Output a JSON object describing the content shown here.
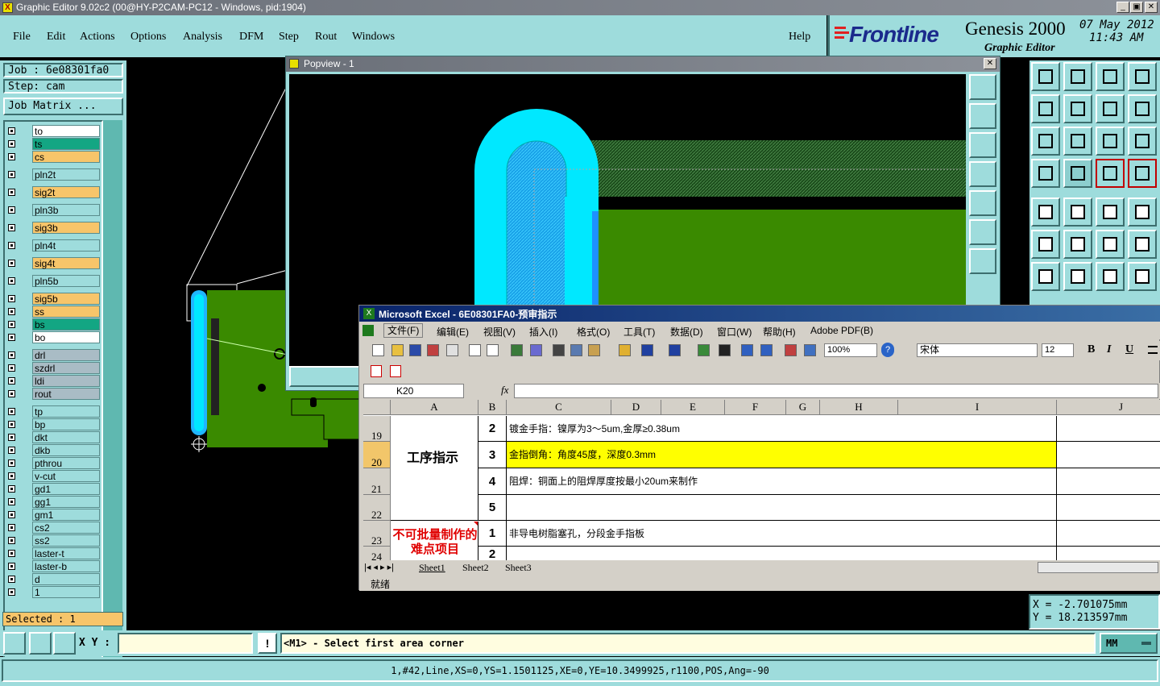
{
  "title_bar": {
    "text": "Graphic Editor 9.02c2 (00@HY-P2CAM-PC12 - Windows, pid:1904)",
    "min": "_",
    "restore": "▣",
    "close": "✕"
  },
  "menu": {
    "items": [
      "File",
      "Edit",
      "Actions",
      "Options",
      "Analysis",
      "DFM",
      "Step",
      "Rout",
      "Windows"
    ],
    "help": "Help"
  },
  "brand": {
    "logo": "Frontline",
    "product": "Genesis 2000",
    "subtitle": "Graphic Editor",
    "date": "07 May 2012",
    "time": "11:43 AM"
  },
  "job": {
    "job_label": "Job : 6e08301fa0",
    "step_label": "Step: cam",
    "matrix_button": "Job Matrix ..."
  },
  "layers": [
    {
      "name": "to",
      "color": "#ffffff"
    },
    {
      "name": "ts",
      "color": "#13a683"
    },
    {
      "name": "cs",
      "color": "#f7c56a"
    },
    {
      "name": "pln2t",
      "color": "#9edcdc"
    },
    {
      "name": "sig2t",
      "color": "#f7c56a"
    },
    {
      "name": "pln3b",
      "color": "#9edcdc"
    },
    {
      "name": "sig3b",
      "color": "#f7c56a"
    },
    {
      "name": "pln4t",
      "color": "#9edcdc"
    },
    {
      "name": "sig4t",
      "color": "#f7c56a"
    },
    {
      "name": "pln5b",
      "color": "#9edcdc"
    },
    {
      "name": "sig5b",
      "color": "#f7c56a"
    },
    {
      "name": "ss",
      "color": "#f7c56a"
    },
    {
      "name": "bs",
      "color": "#13a683"
    },
    {
      "name": "bo",
      "color": "#ffffff"
    },
    {
      "name": "drl",
      "color": "#a9bcc5"
    },
    {
      "name": "szdrl",
      "color": "#a9bcc5"
    },
    {
      "name": "ldi",
      "color": "#a9bcc5"
    },
    {
      "name": "rout",
      "color": "#a9bcc5"
    },
    {
      "name": "tp",
      "color": "#9edcdc"
    },
    {
      "name": "bp",
      "color": "#9edcdc"
    },
    {
      "name": "dkt",
      "color": "#9edcdc"
    },
    {
      "name": "dkb",
      "color": "#9edcdc"
    },
    {
      "name": "pthrou",
      "color": "#9edcdc"
    },
    {
      "name": "v-cut",
      "color": "#9edcdc"
    },
    {
      "name": "gd1",
      "color": "#9edcdc"
    },
    {
      "name": "gg1",
      "color": "#9edcdc"
    },
    {
      "name": "gm1",
      "color": "#9edcdc"
    },
    {
      "name": "cs2",
      "color": "#9edcdc"
    },
    {
      "name": "ss2",
      "color": "#9edcdc"
    },
    {
      "name": "laster-t",
      "color": "#9edcdc"
    },
    {
      "name": "laster-b",
      "color": "#9edcdc"
    },
    {
      "name": "d",
      "color": "#9edcdc"
    },
    {
      "name": "1",
      "color": "#9edcdc"
    }
  ],
  "selected": "Selected : 1",
  "popview": {
    "title": "Popview - 1",
    "close": "✕"
  },
  "coords": {
    "x": "X  = -2.701075mm",
    "y": "Y  = 18.213597mm"
  },
  "bottom": {
    "xy_label": "X Y :",
    "xy_value": "",
    "bang": "!",
    "prompt": "<M1> - Select first area corner",
    "units": "MM"
  },
  "status_line": "1,#42,Line,XS=0,YS=1.1501125,XE=0,YE=10.3499925,r1100,POS,Ang=-90",
  "excel": {
    "title": "Microsoft Excel - 6E08301FA0-预审指示",
    "menu": [
      "文件(F)",
      "编辑(E)",
      "视图(V)",
      "插入(I)",
      "格式(O)",
      "工具(T)",
      "数据(D)",
      "窗口(W)",
      "帮助(H)",
      "Adobe PDF(B)"
    ],
    "zoom": "100%",
    "font": "宋体",
    "font_size": "12",
    "bold": "B",
    "italic": "I",
    "underline": "U",
    "name_box": "K20",
    "fx": "fx",
    "formula": "",
    "columns": [
      "A",
      "B",
      "C",
      "D",
      "E",
      "F",
      "G",
      "H",
      "I",
      "J"
    ],
    "rows": [
      {
        "num": "19",
        "b": "2",
        "c": "镀金手指：镍厚为3～5um,金厚≥0.38um"
      },
      {
        "num": "20",
        "b": "3",
        "c": "金指倒角：角度45度，深度0.3mm"
      },
      {
        "num": "21",
        "b": "4",
        "c": "阻焊：铜面上的阻焊厚度按最小20um来制作"
      },
      {
        "num": "22",
        "b": "5",
        "c": ""
      },
      {
        "num": "23",
        "b": "1",
        "c": "非导电树脂塞孔，分段金手指板"
      },
      {
        "num": "24",
        "b": "2",
        "c": ""
      }
    ],
    "section1": "工序指示",
    "section2": "不可批量制作的难点项目",
    "sheets": [
      "Sheet1",
      "Sheet2",
      "Sheet3"
    ],
    "status": "就绪"
  }
}
